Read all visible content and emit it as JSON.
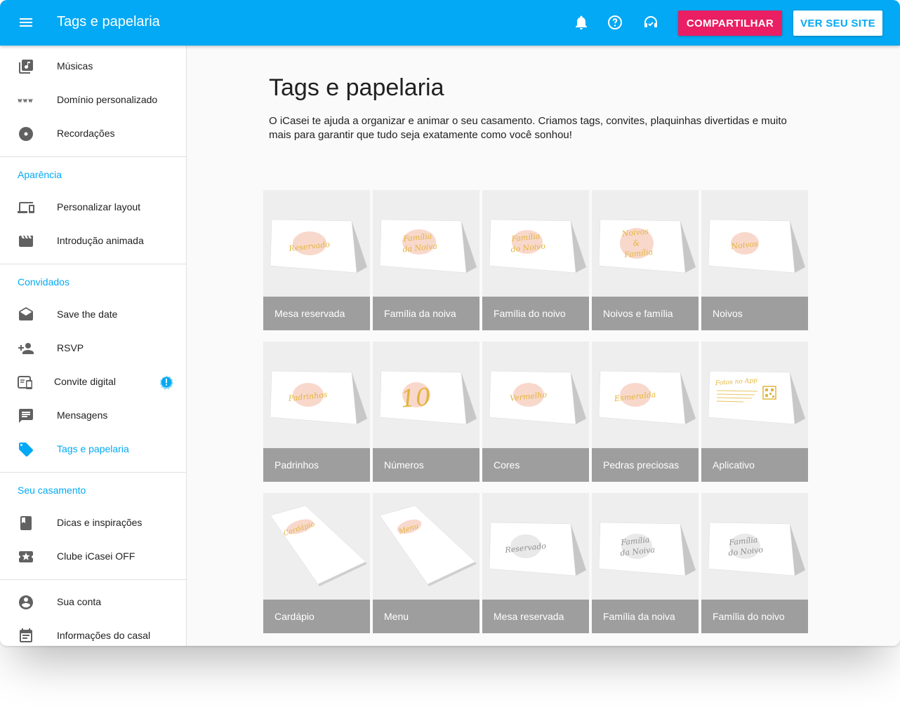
{
  "appbar": {
    "title": "Tags e papelaria",
    "share_label": "COMPARTILHAR",
    "site_label": "VER SEU SITE"
  },
  "sidebar": {
    "items_top": [
      {
        "label": "Músicas",
        "icon": "music-library-icon"
      },
      {
        "label": "Domínio personalizado",
        "icon": "www-icon"
      },
      {
        "label": "Recordações",
        "icon": "disc-icon"
      }
    ],
    "sections": [
      {
        "title": "Aparência",
        "items": [
          {
            "label": "Personalizar layout",
            "icon": "devices-icon"
          },
          {
            "label": "Introdução animada",
            "icon": "movie-icon"
          }
        ]
      },
      {
        "title": "Convidados",
        "items": [
          {
            "label": "Save the date",
            "icon": "envelope-open-icon"
          },
          {
            "label": "RSVP",
            "icon": "person-add-icon"
          },
          {
            "label": "Convite digital",
            "icon": "phone-invite-icon"
          },
          {
            "label": "Mensagens",
            "icon": "message-icon"
          },
          {
            "label": "Tags e papelaria",
            "icon": "tag-icon"
          }
        ]
      },
      {
        "title": "Seu casamento",
        "items": [
          {
            "label": "Dicas e inspirações",
            "icon": "book-icon"
          },
          {
            "label": "Clube iCasei OFF",
            "icon": "ticket-star-icon"
          }
        ]
      }
    ],
    "items_bottom": [
      {
        "label": "Sua conta",
        "icon": "account-circle-icon"
      },
      {
        "label": "Informações do casal",
        "icon": "event-note-icon"
      }
    ],
    "active_item": "Tags e papelaria"
  },
  "main": {
    "title": "Tags e papelaria",
    "description": "O iCasei te ajuda a organizar e animar o seu casamento. Criamos tags, convites, plaquinhas divertidas e muito mais para garantir que tudo seja exatamente como você sonhou!",
    "cards": [
      {
        "label": "Mesa reservada",
        "card_text": [
          "Reservado"
        ]
      },
      {
        "label": "Família da noiva",
        "card_text": [
          "Família",
          "da Noiva"
        ]
      },
      {
        "label": "Família do noivo",
        "card_text": [
          "Família",
          "do Noivo"
        ]
      },
      {
        "label": "Noivos e família",
        "card_text": [
          "Noivos",
          "&",
          "Família"
        ]
      },
      {
        "label": "Noivos",
        "card_text": [
          "Noivos"
        ]
      },
      {
        "label": "Padrinhos",
        "card_text": [
          "Padrinhos"
        ]
      },
      {
        "label": "Números",
        "card_text": [
          "10"
        ]
      },
      {
        "label": "Cores",
        "card_text": [
          "Vermelho"
        ]
      },
      {
        "label": "Pedras preciosas",
        "card_text": [
          "Esmeralda"
        ]
      },
      {
        "label": "Aplicativo",
        "card_text": [
          "Fotos no App"
        ]
      },
      {
        "label": "Cardápio",
        "card_text": [
          "Cardápio"
        ]
      },
      {
        "label": "Menu",
        "card_text": [
          "Menu"
        ]
      },
      {
        "label": "Mesa reservada",
        "card_text": [
          "Reservado"
        ]
      },
      {
        "label": "Família da noiva",
        "card_text": [
          "Família",
          "da Noiva"
        ]
      },
      {
        "label": "Família do noivo",
        "card_text": [
          "Família",
          "do Noivo"
        ]
      }
    ]
  },
  "colors": {
    "primary": "#03a9f4",
    "accent": "#e91e63",
    "card_label_bg": "#9e9e9e",
    "card_bg": "#eeeeee",
    "gold": "#e2b53c",
    "blush": "#f7c7b6"
  }
}
